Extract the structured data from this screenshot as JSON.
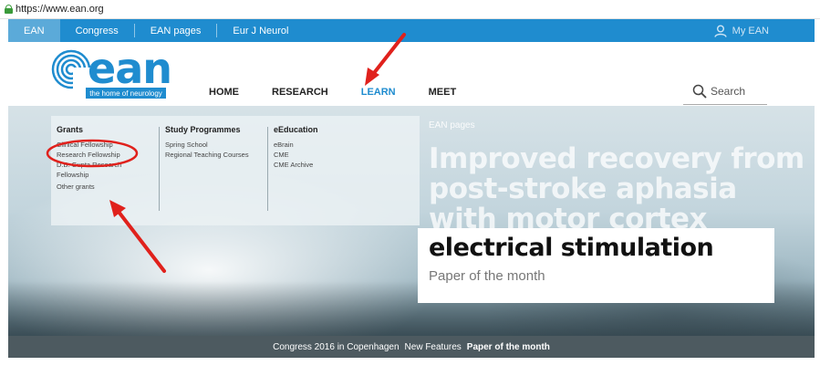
{
  "browser": {
    "url": "https://www.ean.org"
  },
  "topbar": {
    "tabs": [
      {
        "label": "EAN",
        "active": true
      },
      {
        "label": "Congress",
        "active": false
      },
      {
        "label": "EAN pages",
        "active": false
      },
      {
        "label": "Eur J Neurol",
        "active": false
      }
    ],
    "my_ean_label": "My EAN"
  },
  "header": {
    "logo_word": "ean",
    "logo_tagline": "the home of neurology",
    "nav": [
      {
        "label": "HOME",
        "active": false
      },
      {
        "label": "RESEARCH",
        "active": false
      },
      {
        "label": "LEARN",
        "active": true
      },
      {
        "label": "MEET",
        "active": false
      }
    ],
    "search_label": "Search"
  },
  "mega_menu": {
    "columns": [
      {
        "heading": "Grants",
        "links": [
          "Clinical Fellowship",
          "Research Fellowship",
          "D.B. Gupta Research Fellowship",
          "Other grants"
        ]
      },
      {
        "heading": "Study Programmes",
        "links": [
          "Spring School",
          "Regional Teaching Courses"
        ]
      },
      {
        "heading": "eEducation",
        "links": [
          "eBrain",
          "CME",
          "CME Archive"
        ]
      }
    ]
  },
  "hero": {
    "page_label": "EAN pages",
    "headline": "Improved recovery from post-stroke aphasia with motor cortex",
    "bold_line": "electrical stimulation",
    "sub_line": "Paper of the month"
  },
  "footer": {
    "items": [
      {
        "label": "Congress 2016 in Copenhagen",
        "bold": false
      },
      {
        "label": "New Features",
        "bold": false
      },
      {
        "label": "Paper of the month",
        "bold": true
      }
    ]
  },
  "colors": {
    "brand_blue": "#1f8ccf",
    "annotation_red": "#e0211c"
  }
}
